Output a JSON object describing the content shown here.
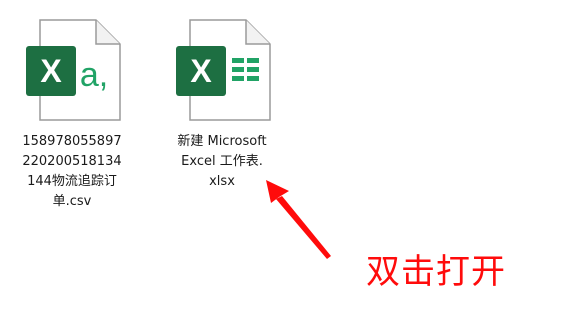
{
  "files": [
    {
      "type": "csv",
      "name": "158978055897220200518134144物流追踪订单.csv",
      "name_lines": [
        "158978055897",
        "220200518134",
        "144物流追踪订",
        "单.csv"
      ],
      "badge_letter": "X",
      "badge_suffix": "a,",
      "icon": "excel-csv-file-icon",
      "accent": "#1d6f42",
      "suffix_color": "#21a366"
    },
    {
      "type": "xlsx",
      "name": "新建 Microsoft Excel 工作表.xlsx",
      "name_lines": [
        "新建 Microsoft",
        "Excel 工作表.",
        "xlsx"
      ],
      "badge_letter": "X",
      "icon": "excel-xlsx-file-icon",
      "accent": "#1d6f42",
      "grid_color": "#21a366"
    }
  ],
  "annotation": {
    "text": "双击打开",
    "color": "#ff0b0b",
    "icon": "red-arrow-icon"
  }
}
